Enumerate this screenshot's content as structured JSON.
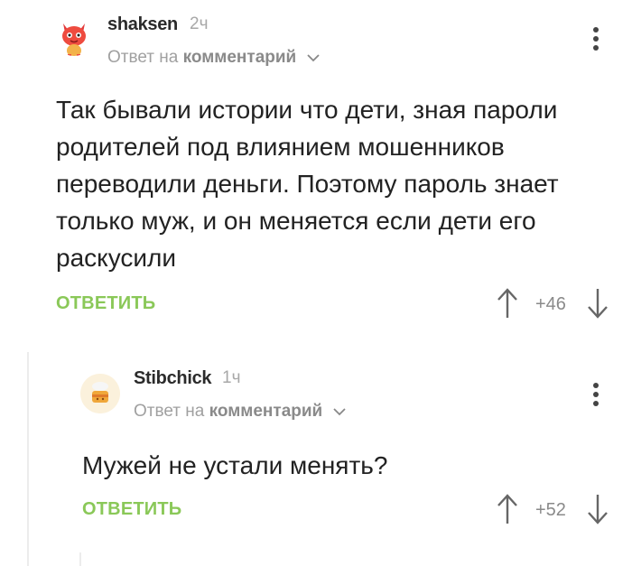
{
  "comments": [
    {
      "username": "shaksen",
      "time": "2ч",
      "reply_prefix": "Ответ на",
      "reply_target": "комментарий",
      "body": "Так бывали истории что дети, зная пароли родителей под влиянием мошенников переводили деньги. Поэтому пароль знает только муж, и он меняется если дети его раскусили",
      "reply_button": "ОТВЕТИТЬ",
      "score": "+46",
      "avatar_icon": "dragon-avatar-icon"
    },
    {
      "username": "Stibchick",
      "time": "1ч",
      "reply_prefix": "Ответ на",
      "reply_target": "комментарий",
      "body": "Мужей не устали менять?",
      "reply_button": "ОТВЕТИТЬ",
      "score": "+52",
      "avatar_icon": "cake-avatar-icon"
    }
  ],
  "colors": {
    "accent_green": "#8ac858",
    "muted_text": "#a0a0a0",
    "thread_line": "#ececec"
  }
}
